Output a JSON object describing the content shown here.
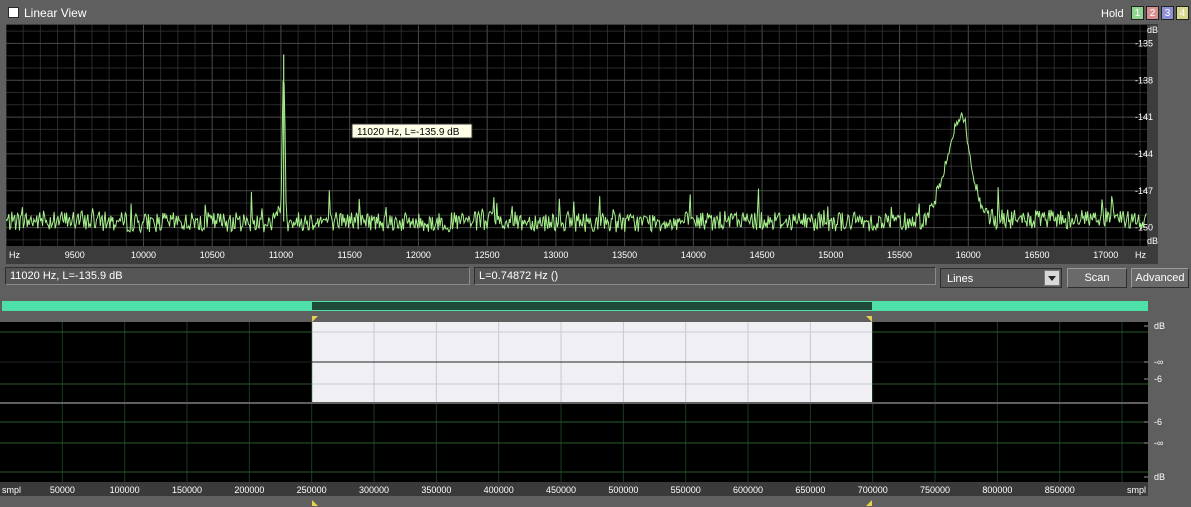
{
  "window": {
    "title": "Linear View"
  },
  "hold": {
    "label": "Hold",
    "buttons": [
      {
        "label": "1",
        "color": "#8fd48f"
      },
      {
        "label": "2",
        "color": "#d88f8f"
      },
      {
        "label": "3",
        "color": "#8f8fd8"
      },
      {
        "label": "4",
        "color": "#d8d88f"
      }
    ]
  },
  "spectrum": {
    "x_unit": "Hz",
    "x_ticks": [
      "9500",
      "10000",
      "10500",
      "11000",
      "11500",
      "12000",
      "12500",
      "13000",
      "13500",
      "14000",
      "14500",
      "15000",
      "15500",
      "16000",
      "16500",
      "17000"
    ],
    "y_unit": "dB",
    "y_ticks": [
      "-135",
      "-138",
      "-141",
      "-144",
      "-147",
      "-150"
    ],
    "tooltip": "11020 Hz, L=-135.9 dB",
    "line_color": "#a6f08c",
    "grid_color": "#4a4a4a"
  },
  "status": {
    "cursor_readout": "11020 Hz, L=-135.9 dB",
    "resolution": "L=0.74872 Hz ()",
    "mode_select": "Lines",
    "scan_label": "Scan",
    "advanced_label": "Advanced"
  },
  "overview": {
    "x_unit": "smpl",
    "x_ticks": [
      "50000",
      "100000",
      "150000",
      "200000",
      "250000",
      "300000",
      "350000",
      "400000",
      "450000",
      "500000",
      "550000",
      "600000",
      "650000",
      "700000",
      "750000",
      "800000",
      "850000"
    ],
    "track1_labels": [
      "dB",
      "-∞",
      "-6"
    ],
    "track2_labels": [
      "-6",
      "-∞",
      "dB"
    ],
    "selection_color": "#f0f0f4",
    "scroll_color": "#4ee0a8"
  },
  "chart_data": {
    "type": "line",
    "title": "",
    "xlabel": "Hz",
    "ylabel": "dB",
    "xlim": [
      9000,
      17300
    ],
    "ylim": [
      -151.5,
      -133.5
    ],
    "noise_floor": -149.5,
    "x": [
      9000,
      9500,
      10000,
      10500,
      10950,
      11000,
      11020,
      11040,
      11100,
      11500,
      12000,
      12500,
      13000,
      13500,
      14000,
      14500,
      15000,
      15500,
      15700,
      15800,
      15850,
      15900,
      15950,
      15980,
      16000,
      16050,
      16100,
      16200,
      16500,
      17000,
      17300
    ],
    "y": [
      -149.5,
      -149.4,
      -149.6,
      -149.5,
      -149.6,
      -148.5,
      -135.9,
      -149.5,
      -149.5,
      -149.4,
      -149.6,
      -149.5,
      -149.5,
      -149.6,
      -149.5,
      -149.4,
      -149.5,
      -149.5,
      -149.3,
      -146.5,
      -144.0,
      -142.0,
      -140.8,
      -141.5,
      -143.5,
      -146.5,
      -148.6,
      -149.3,
      -149.4,
      -149.2,
      -149.5
    ],
    "grid": true
  }
}
